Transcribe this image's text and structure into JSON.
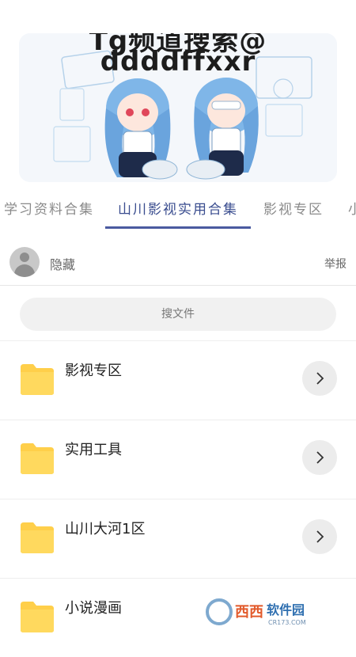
{
  "banner": {
    "line1": "Tg频道搜索@",
    "line2": "ddddffxxr"
  },
  "tabs": [
    {
      "label": "学习资料合集"
    },
    {
      "label": "山川影视实用合集"
    },
    {
      "label": "影视专区"
    },
    {
      "label": "小"
    }
  ],
  "user": {
    "name": "隐藏",
    "report_label": "举报"
  },
  "search": {
    "placeholder": "搜文件"
  },
  "folders": [
    {
      "label": "影视专区",
      "icon": "folder-icon"
    },
    {
      "label": "实用工具",
      "icon": "folder-icon"
    },
    {
      "label": "山川大河1区",
      "icon": "folder-icon"
    },
    {
      "label": "小说漫画",
      "icon": "folder-icon"
    }
  ],
  "watermark": {
    "text1": "西西",
    "text2": "软件园",
    "text3": "CR173.COM"
  },
  "colors": {
    "accent": "#4a5aa0",
    "folder": "#ffcf4a"
  }
}
